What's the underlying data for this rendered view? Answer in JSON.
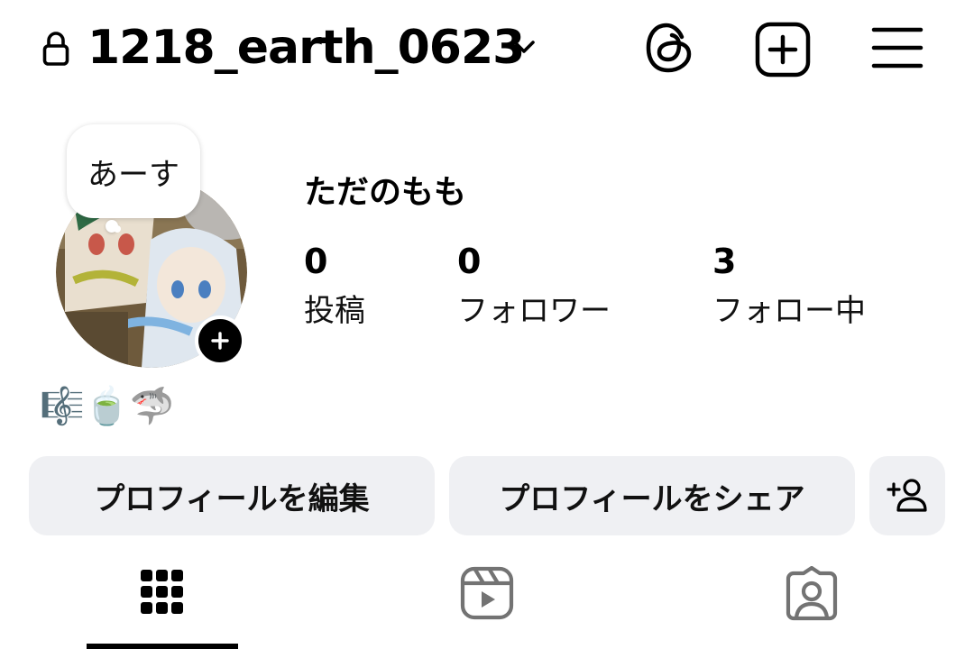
{
  "header": {
    "username": "1218_earth_0623",
    "icons": [
      "lock-icon",
      "chevron-down-icon",
      "threads-icon",
      "create-plus-icon",
      "menu-icon"
    ]
  },
  "profile": {
    "note": "あーす",
    "display_name": "ただのもも",
    "stats": [
      {
        "count": "0",
        "label": "投稿"
      },
      {
        "count": "0",
        "label": "フォロワー"
      },
      {
        "count": "3",
        "label": "フォロー中"
      }
    ],
    "bio": "🎼🍵🦈"
  },
  "actions": {
    "edit_profile": "プロフィールを編集",
    "share_profile": "プロフィールをシェア",
    "discover_icon": "add-person-icon"
  },
  "tabs": [
    {
      "icon": "grid-icon",
      "active": true
    },
    {
      "icon": "reels-icon",
      "active": false
    },
    {
      "icon": "tagged-icon",
      "active": false
    }
  ],
  "colors": {
    "text": "#000000",
    "button_bg": "#eff0f3",
    "inactive_icon": "#737373"
  }
}
